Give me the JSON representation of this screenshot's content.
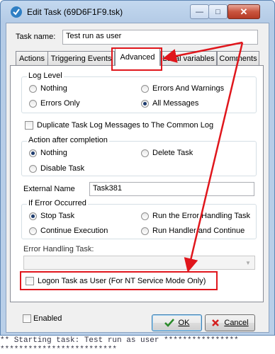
{
  "window": {
    "title": "Edit Task (69D6F1F9.tsk)",
    "minimize_glyph": "—",
    "maximize_glyph": "□",
    "close_glyph": "✕"
  },
  "task_name": {
    "label": "Task name:",
    "value": "Test run as user"
  },
  "tabs": [
    {
      "label": "Actions"
    },
    {
      "label": "Triggering Events"
    },
    {
      "label": "Advanced"
    },
    {
      "label": "Local variables"
    },
    {
      "label": "Comments"
    }
  ],
  "log_level": {
    "legend": "Log Level",
    "options": [
      "Nothing",
      "Errors And Warnings",
      "Errors Only",
      "All Messages"
    ],
    "selected": "All Messages"
  },
  "duplicate_log": {
    "label": "Duplicate Task Log Messages to The Common Log",
    "checked": false
  },
  "action_after": {
    "legend": "Action after completion",
    "options": [
      "Nothing",
      "Delete Task",
      "Disable Task"
    ],
    "selected": "Nothing"
  },
  "external_name": {
    "label": "External Name",
    "value": "Task381"
  },
  "if_error": {
    "legend": "If Error Occurred",
    "options": [
      "Stop Task",
      "Run the Error Handling Task",
      "Continue Execution",
      "Run Handler and Continue"
    ],
    "selected": "Stop Task"
  },
  "error_task": {
    "label": "Error Handling Task:",
    "value": ""
  },
  "logon_as_user": {
    "label": "Logon Task as User (For NT Service Mode Only)",
    "checked": false
  },
  "enabled": {
    "label": "Enabled",
    "checked": false
  },
  "buttons": {
    "ok": "OK",
    "cancel": "Cancel"
  },
  "log_lines": [
    "** Starting task: Test run as user ****************",
    "            *************************"
  ],
  "colors": {
    "annotation": "#e0161c",
    "window_frame": "#b9cfe8"
  }
}
